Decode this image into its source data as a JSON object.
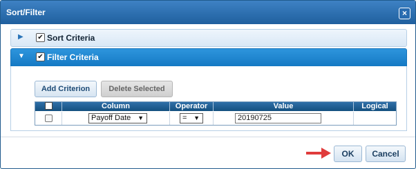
{
  "dialog": {
    "title": "Sort/Filter",
    "close_glyph": "×"
  },
  "sort_section": {
    "label": "Sort Criteria",
    "checked_glyph": "✔",
    "arrow_glyph": "▶"
  },
  "filter_section": {
    "label": "Filter Criteria",
    "checked_glyph": "✔",
    "arrow_glyph": "▼"
  },
  "toolbar": {
    "add_label": "Add Criterion",
    "delete_label": "Delete Selected"
  },
  "grid": {
    "headers": {
      "column": "Column",
      "operator": "Operator",
      "value": "Value",
      "logical": "Logical"
    },
    "rows": [
      {
        "column": "Payoff Date",
        "operator": "=",
        "value": "20190725",
        "logical": ""
      }
    ],
    "caret_glyph": "▼"
  },
  "footer": {
    "ok_label": "OK",
    "cancel_label": "Cancel"
  },
  "colors": {
    "title_bar": "#1f5f9e",
    "filter_header": "#1479c4",
    "arrow_annotation": "#e03c3c"
  }
}
